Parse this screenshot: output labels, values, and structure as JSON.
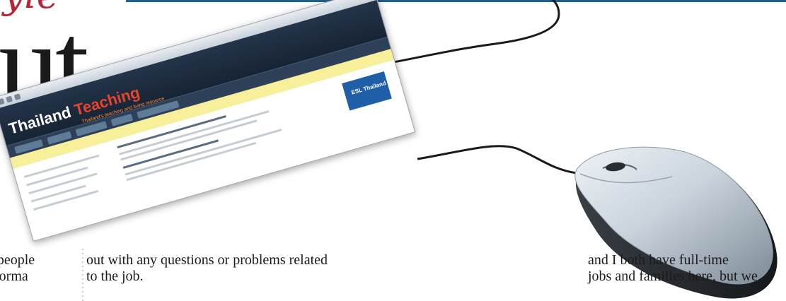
{
  "headline": {
    "script_fragment": "yle",
    "large_fragment": "ut"
  },
  "screenshot": {
    "logo_text": "Thailand",
    "logo_accent": "Teaching",
    "tagline": "Thailand's teaching and living resource",
    "ad_label": "ESL Thailand"
  },
  "article": {
    "column1": [
      "e people",
      "nforma"
    ],
    "column2": [
      "out with any questions or problems related",
      "to the job."
    ],
    "column3": [
      "and I both have full-time",
      "jobs and families here, but we"
    ]
  },
  "colors": {
    "rule": "#1e5f8c",
    "script_red": "#b3263a",
    "logo_accent": "#e8442c",
    "mouse_silver": "#c9d3dc"
  }
}
